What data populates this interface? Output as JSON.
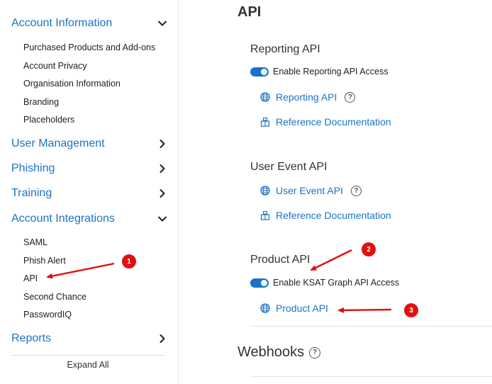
{
  "sidebar": {
    "sections": [
      {
        "label": "Account Information",
        "expanded": true
      },
      {
        "label": "User Management",
        "expanded": false
      },
      {
        "label": "Phishing",
        "expanded": false
      },
      {
        "label": "Training",
        "expanded": false
      },
      {
        "label": "Account Integrations",
        "expanded": true
      },
      {
        "label": "Reports",
        "expanded": false
      }
    ],
    "account_information_items": [
      "Purchased Products and Add-ons",
      "Account Privacy",
      "Organisation Information",
      "Branding",
      "Placeholders"
    ],
    "account_integrations_items": [
      "SAML",
      "Phish Alert",
      "API",
      "Second Chance",
      "PasswordIQ"
    ],
    "expand_all": "Expand All"
  },
  "main": {
    "title": "API",
    "reporting": {
      "title": "Reporting API",
      "toggle_label": "Enable Reporting API Access",
      "toggle_on": true,
      "link_label": "Reporting API",
      "help": "?",
      "docs_label": "Reference Documentation"
    },
    "user_event": {
      "title": "User Event API",
      "link_label": "User Event API",
      "help": "?",
      "docs_label": "Reference Documentation"
    },
    "product": {
      "title": "Product API",
      "toggle_label": "Enable KSAT Graph API Access",
      "toggle_on": true,
      "link_label": "Product API"
    },
    "webhooks": {
      "title": "Webhooks",
      "help": "?"
    }
  },
  "annotations": {
    "badges": [
      "1",
      "2",
      "3"
    ],
    "color": "#e01010"
  },
  "colors": {
    "accent": "#1a73c8",
    "toggle_on": "#1a73c8"
  },
  "icons": [
    "chevron-down-icon",
    "chevron-right-icon",
    "globe-icon",
    "docs-box-icon",
    "help-circle-icon"
  ]
}
